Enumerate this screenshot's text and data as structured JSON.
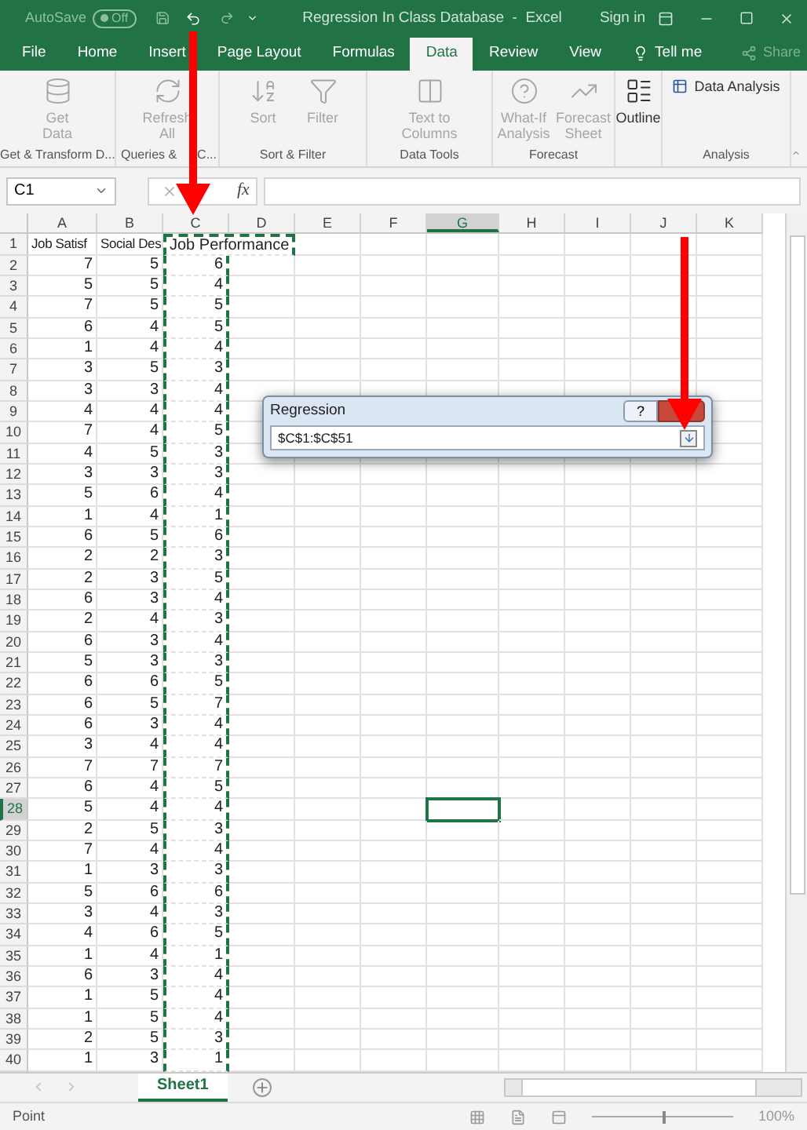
{
  "title_bar": {
    "autosave_label": "AutoSave",
    "autosave_value": "Off",
    "title": "Regression In Class Database  -  Excel",
    "sign_in": "Sign in"
  },
  "tabs": [
    {
      "label": "File",
      "selected": false
    },
    {
      "label": "Home",
      "selected": false
    },
    {
      "label": "Insert",
      "selected": false
    },
    {
      "label": "Page Layout",
      "selected": false
    },
    {
      "label": "Formulas",
      "selected": false
    },
    {
      "label": "Data",
      "selected": true
    },
    {
      "label": "Review",
      "selected": false
    },
    {
      "label": "View",
      "selected": false
    },
    {
      "label": "Tell me",
      "selected": false
    }
  ],
  "share": "Share",
  "ribbon_groups": [
    {
      "label": "Get & Transform D...",
      "buttons": [
        {
          "label": "Get Data",
          "disabled": true
        }
      ]
    },
    {
      "label_parts": [
        "Queries &",
        "C..."
      ],
      "buttons": [
        {
          "label": "Refresh All",
          "disabled": true
        }
      ]
    },
    {
      "label": "Sort & Filter",
      "buttons": [
        {
          "label": "Sort",
          "disabled": true
        },
        {
          "label": "Filter",
          "disabled": true
        }
      ]
    },
    {
      "label": "Data Tools",
      "buttons": [
        {
          "label": "Text to Columns",
          "disabled": true
        }
      ]
    },
    {
      "label": "Forecast",
      "buttons": [
        {
          "label": "What-If Analysis",
          "disabled": true
        },
        {
          "label": "Forecast Sheet",
          "disabled": true
        }
      ]
    },
    {
      "buttons": [
        {
          "label": "Outline",
          "disabled": false
        }
      ]
    },
    {
      "label": "Analysis",
      "buttons": [
        {
          "label": "Data Analysis",
          "disabled": false
        }
      ]
    }
  ],
  "formula_bar": {
    "name_box": "C1",
    "fx": "fx"
  },
  "columns": [
    {
      "label": "A",
      "selected": false,
      "marquee": false
    },
    {
      "label": "B",
      "selected": false,
      "marquee": false
    },
    {
      "label": "C",
      "selected": false,
      "marquee": true
    },
    {
      "label": "D",
      "selected": false,
      "marquee": false
    },
    {
      "label": "E",
      "selected": false,
      "marquee": false
    },
    {
      "label": "F",
      "selected": false,
      "marquee": false
    },
    {
      "label": "G",
      "selected": true,
      "marquee": false
    },
    {
      "label": "H",
      "selected": false,
      "marquee": false
    },
    {
      "label": "I",
      "selected": false,
      "marquee": false
    },
    {
      "label": "J",
      "selected": false,
      "marquee": false
    },
    {
      "label": "K",
      "selected": false,
      "marquee": false
    }
  ],
  "rows": [
    {
      "number": "1",
      "selected": false,
      "cells": [
        "Job Satisf",
        "Social Des",
        "Job Performance"
      ]
    },
    {
      "number": "2",
      "selected": false,
      "cells": [
        "7",
        "5",
        "6"
      ]
    },
    {
      "number": "3",
      "selected": false,
      "cells": [
        "5",
        "5",
        "4"
      ]
    },
    {
      "number": "4",
      "selected": false,
      "cells": [
        "7",
        "5",
        "5"
      ]
    },
    {
      "number": "5",
      "selected": false,
      "cells": [
        "6",
        "4",
        "5"
      ]
    },
    {
      "number": "6",
      "selected": false,
      "cells": [
        "1",
        "4",
        "4"
      ]
    },
    {
      "number": "7",
      "selected": false,
      "cells": [
        "3",
        "5",
        "3"
      ]
    },
    {
      "number": "8",
      "selected": false,
      "cells": [
        "3",
        "3",
        "4"
      ]
    },
    {
      "number": "9",
      "selected": false,
      "cells": [
        "4",
        "4",
        "4"
      ]
    },
    {
      "number": "10",
      "selected": false,
      "cells": [
        "7",
        "4",
        "5"
      ]
    },
    {
      "number": "11",
      "selected": false,
      "cells": [
        "4",
        "5",
        "3"
      ]
    },
    {
      "number": "12",
      "selected": false,
      "cells": [
        "3",
        "3",
        "3"
      ]
    },
    {
      "number": "13",
      "selected": false,
      "cells": [
        "5",
        "6",
        "4"
      ]
    },
    {
      "number": "14",
      "selected": false,
      "cells": [
        "1",
        "4",
        "1"
      ]
    },
    {
      "number": "15",
      "selected": false,
      "cells": [
        "6",
        "5",
        "6"
      ]
    },
    {
      "number": "16",
      "selected": false,
      "cells": [
        "2",
        "2",
        "3"
      ]
    },
    {
      "number": "17",
      "selected": false,
      "cells": [
        "2",
        "3",
        "5"
      ]
    },
    {
      "number": "18",
      "selected": false,
      "cells": [
        "6",
        "3",
        "4"
      ]
    },
    {
      "number": "19",
      "selected": false,
      "cells": [
        "2",
        "4",
        "3"
      ]
    },
    {
      "number": "20",
      "selected": false,
      "cells": [
        "6",
        "3",
        "4"
      ]
    },
    {
      "number": "21",
      "selected": false,
      "cells": [
        "5",
        "3",
        "3"
      ]
    },
    {
      "number": "22",
      "selected": false,
      "cells": [
        "6",
        "6",
        "5"
      ]
    },
    {
      "number": "23",
      "selected": false,
      "cells": [
        "6",
        "5",
        "7"
      ]
    },
    {
      "number": "24",
      "selected": false,
      "cells": [
        "6",
        "3",
        "4"
      ]
    },
    {
      "number": "25",
      "selected": false,
      "cells": [
        "3",
        "4",
        "4"
      ]
    },
    {
      "number": "26",
      "selected": false,
      "cells": [
        "7",
        "7",
        "7"
      ]
    },
    {
      "number": "27",
      "selected": false,
      "cells": [
        "6",
        "4",
        "5"
      ]
    },
    {
      "number": "28",
      "selected": true,
      "cells": [
        "5",
        "4",
        "4"
      ]
    },
    {
      "number": "29",
      "selected": false,
      "cells": [
        "2",
        "5",
        "3"
      ]
    },
    {
      "number": "30",
      "selected": false,
      "cells": [
        "7",
        "4",
        "4"
      ]
    },
    {
      "number": "31",
      "selected": false,
      "cells": [
        "1",
        "3",
        "3"
      ]
    },
    {
      "number": "32",
      "selected": false,
      "cells": [
        "5",
        "6",
        "6"
      ]
    },
    {
      "number": "33",
      "selected": false,
      "cells": [
        "3",
        "4",
        "3"
      ]
    },
    {
      "number": "34",
      "selected": false,
      "cells": [
        "4",
        "6",
        "5"
      ]
    },
    {
      "number": "35",
      "selected": false,
      "cells": [
        "1",
        "4",
        "1"
      ]
    },
    {
      "number": "36",
      "selected": false,
      "cells": [
        "6",
        "3",
        "4"
      ]
    },
    {
      "number": "37",
      "selected": false,
      "cells": [
        "1",
        "5",
        "4"
      ]
    },
    {
      "number": "38",
      "selected": false,
      "cells": [
        "1",
        "5",
        "4"
      ]
    },
    {
      "number": "39",
      "selected": false,
      "cells": [
        "2",
        "5",
        "3"
      ]
    },
    {
      "number": "40",
      "selected": false,
      "cells": [
        "1",
        "3",
        "1"
      ]
    }
  ],
  "dialog": {
    "title": "Regression",
    "help": "?",
    "value": "$C$1:$C$51"
  },
  "sheet_tabs": [
    {
      "label": "Sheet1",
      "selected": true
    }
  ],
  "status_bar": {
    "mode": "Point",
    "zoom_slider": {
      "level": 0.5
    },
    "zoom": "100%"
  }
}
